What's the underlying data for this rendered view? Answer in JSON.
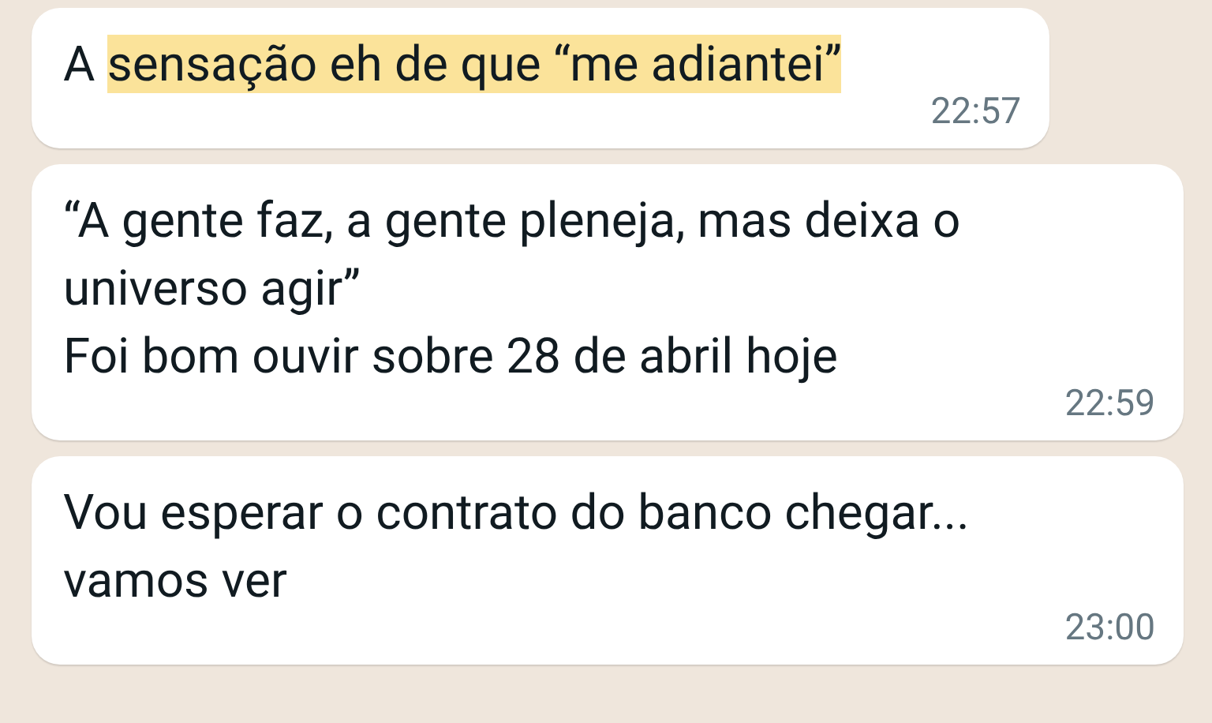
{
  "messages": [
    {
      "segments": [
        {
          "text": "A ",
          "highlighted": false
        },
        {
          "text": "sensação eh de que “me adiantei”",
          "highlighted": true
        }
      ],
      "time": "22:57"
    },
    {
      "segments": [
        {
          "text": "“A gente faz, a gente pleneja, mas deixa o universo agir”\nFoi bom ouvir sobre 28 de abril hoje",
          "highlighted": false
        }
      ],
      "time": "22:59"
    },
    {
      "segments": [
        {
          "text": "Vou esperar o contrato do banco chegar... vamos ver",
          "highlighted": false
        }
      ],
      "time": "23:00"
    }
  ]
}
